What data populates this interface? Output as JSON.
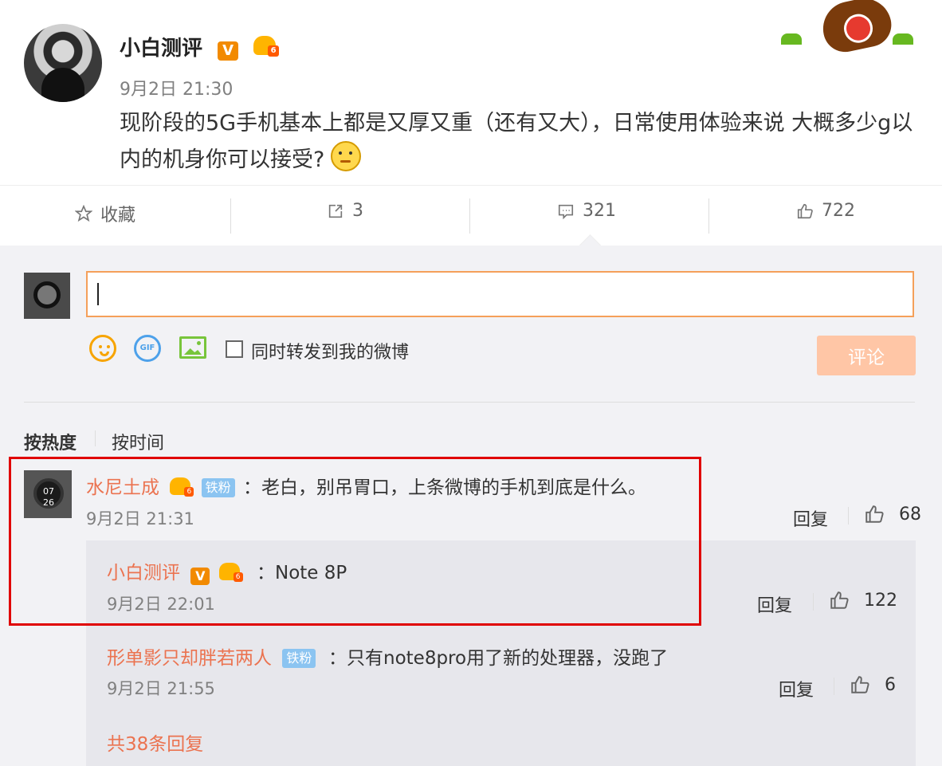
{
  "post": {
    "author": "小白测评",
    "verified_badge": "V",
    "time": "9月2日 21:30",
    "content": "现阶段的5G手机基本上都是又厚又重（还有又大），日常使用体验来说 大概多少g以内的机身你可以接受?"
  },
  "actions": {
    "favorite_label": "收藏",
    "repost_count": "3",
    "comment_count": "321",
    "like_count": "722"
  },
  "composer": {
    "share_label": "同时转发到我的微博",
    "submit_label": "评论"
  },
  "sort": {
    "hot": "按热度",
    "time": "按时间"
  },
  "comments": [
    {
      "author": "水尼土成",
      "badge": "铁粉",
      "text": "：老白，别吊胃口，上条微博的手机到底是什么。",
      "time": "9月2日 21:31",
      "reply_label": "回复",
      "likes": "68",
      "replies": [
        {
          "author": "小白测评",
          "badge": "V",
          "text": "：Note 8P",
          "time": "9月2日 22:01",
          "reply_label": "回复",
          "likes": "122"
        },
        {
          "author": "形单影只却胖若两人",
          "badge": "铁粉",
          "text": "：只有note8pro用了新的处理器，没跑了",
          "time": "9月2日 21:55",
          "reply_label": "回复",
          "likes": "6"
        }
      ],
      "more_replies": "共38条回复"
    }
  ]
}
